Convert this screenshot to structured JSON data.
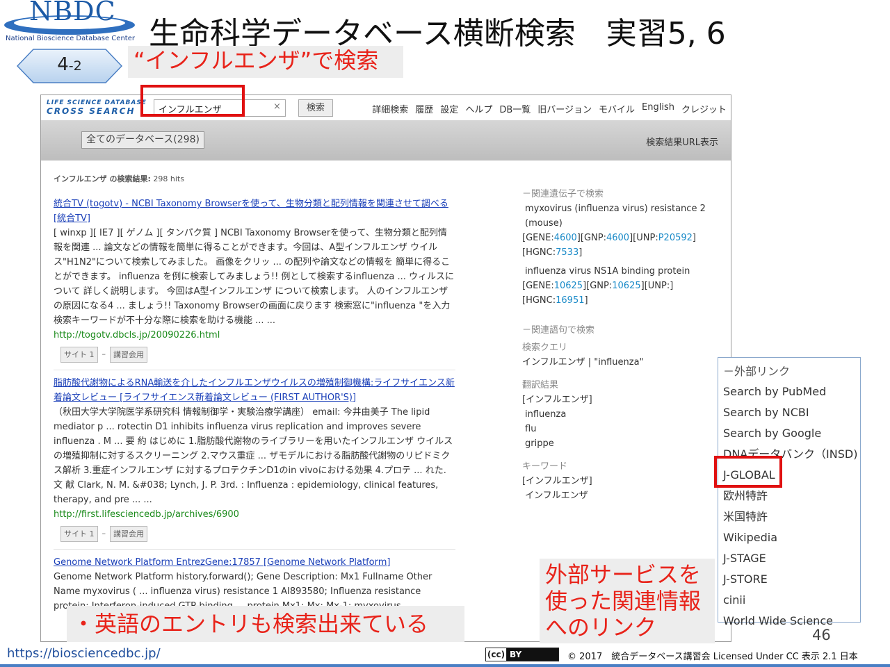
{
  "slide": {
    "logo_text": "NBDC",
    "logo_subtitle": "National Bioscience Database Center",
    "title": "生命科学データベース横断検索　実習5, 6",
    "step_tag_main": "4",
    "step_tag_sub": "-2",
    "step_caption": "“インフルエンザ”で検索",
    "callout_english": "・英語のエントリも検索出来ている",
    "callout_external": [
      "外部サービスを",
      "使った関連情報",
      "へのリンク"
    ],
    "page_number": "46",
    "footer_url": "https://biosciencedbc.jp/",
    "cc_badge": {
      "cc": "(cc)",
      "by": "BY"
    },
    "license": "© 2017　統合データベース講習会 Licensed Under CC 表示 2.1 日本"
  },
  "app": {
    "logo_line1": "LIFE SCIENCE DATABASE",
    "logo_line2": "CROSS SEARCH",
    "search_value": "インフルエンザ",
    "clear_glyph": "×",
    "search_button": "検索",
    "nav": [
      "詳細検索",
      "履歴",
      "設定",
      "ヘルプ",
      "DB一覧",
      "旧バージョン",
      "モバイル",
      "English",
      "クレジット"
    ],
    "db_filter": "全てのデータベース(298)",
    "url_display": "検索結果URL表示",
    "hits_label": "インフルエンザ の検索結果:",
    "hits_count": "298 hits"
  },
  "results": [
    {
      "title": "統合TV (togotv) - NCBI Taxonomy Browserを使って、生物分類と配列情報を関連させて調べる [統合TV]",
      "snippet": "[ winxp ][ IE7 ][ ゲノム ][ タンパク質 ] NCBI Taxonomy Browserを使って、生物分類と配列情報を関連 ... 論文などの情報を簡単に得ることができます。今回は、A型インフルエンザ ウイルス\"H1N2\"について検索してみました。 画像をクリッ ... の配列や論文などの情報を 簡単に得ることができます。 influenza を例に検索してみましょう!! 例として検索するinfluenza ... ウィルスについて 詳しく説明します。 今回はA型インフルエンザ について検索します。 人のインフルエンザ の原因になる4 ... ましょう!! Taxonomy Browserの画面に戻ります 検索窓に\"influenza \"を入力 検索キーワードが不十分な際に検索を助ける機能 ... ...",
      "url": "http://togotv.dbcls.jp/20090226.html",
      "tags": [
        "サイト 1",
        "–",
        "講習会用"
      ]
    },
    {
      "title": "脂肪酸代謝物によるRNA輸送を介したインフルエンザウイルスの増殖制御機構:ライフサイエンス新着論文レビュー [ライフサイエンス新着論文レビュー (FIRST AUTHOR'S)]",
      "snippet": "（秋田大学大学院医学系研究科 情報制御学・実験治療学講座） email: 今井由美子 The lipid mediator p ... rotectin D1 inhibits influenza virus replication and improves severe influenza . M ... 要 約 はじめに 1.脂肪酸代謝物のライブラリーを用いたインフルエンザ ウイルスの増殖抑制に対するスクリーニング 2.マウス重症 ... ザモデルにおける脂肪酸代謝物のリピドミクス解析 3.重症インフルエンザ に対するプロテクチンD1のin vivoにおける効果 4.プロテ ... れた. 文 献 Clark, N. M. &#038; Lynch, J. P. 3rd. : Influenza : epidemiology, clinical features, therapy, and pre ... ...",
      "url": "http://first.lifesciencedb.jp/archives/6900",
      "tags": [
        "サイト 1",
        "–",
        "講習会用"
      ]
    },
    {
      "title": "Genome Network Platform EntrezGene:17857 [Genome Network Platform]",
      "snippet": "Genome Network Platform history.forward(); Gene Description: Mx1 Fullname Other Name myxovirus ( ... influenza virus) resistance 1 AI893580; Influenza resistance protein: Interferon-induced GTP-binding ... protein Mx1; Mx; Mx-1; myxovirus"
    }
  ],
  "sidebar": {
    "gene_header": "関連遺伝子で検索",
    "gene1_name": "myxovirus (influenza virus) resistance 2 (mouse)",
    "gene1_ids": [
      {
        "k": "GENE",
        "v": "4600"
      },
      {
        "k": "GNP",
        "v": "4600"
      },
      {
        "k": "UNP",
        "v": "P20592"
      },
      {
        "k": "HGNC",
        "v": "7533"
      }
    ],
    "gene2_name": "influenza virus NS1A binding protein",
    "gene2_ids": [
      {
        "k": "GENE",
        "v": "10625"
      },
      {
        "k": "GNP",
        "v": "10625"
      },
      {
        "k": "UNP",
        "v": ""
      },
      {
        "k": "HGNC",
        "v": "16951"
      }
    ],
    "term_header": "関連語句で検索",
    "query_label": "検索クエリ",
    "query_value": "インフルエンザ | \"influenza\"",
    "translation_label": "翻訳結果",
    "translation_head": "[インフルエンザ]",
    "translations": [
      "influenza",
      "flu",
      "grippe"
    ],
    "keyword_label": "キーワード",
    "keyword_head": "[インフルエンザ]",
    "keywords": [
      "インフルエンザ"
    ]
  },
  "external_links": {
    "header": "外部リンク",
    "items": [
      "Search by PubMed",
      "Search by NCBI",
      "Search by Google",
      "DNAデータバンク（INSD)",
      "J-GLOBAL",
      "欧州特許",
      "米国特許",
      "Wikipedia",
      "J-STAGE",
      "J-STORE",
      "cinii",
      "World Wide Science"
    ]
  },
  "colors": {
    "highlight_red": "#e01010",
    "caption_red": "#e8231a",
    "link_blue": "#1a3fb8",
    "url_green": "#1a8a1a",
    "keyword_bg": "#fff3b0"
  }
}
